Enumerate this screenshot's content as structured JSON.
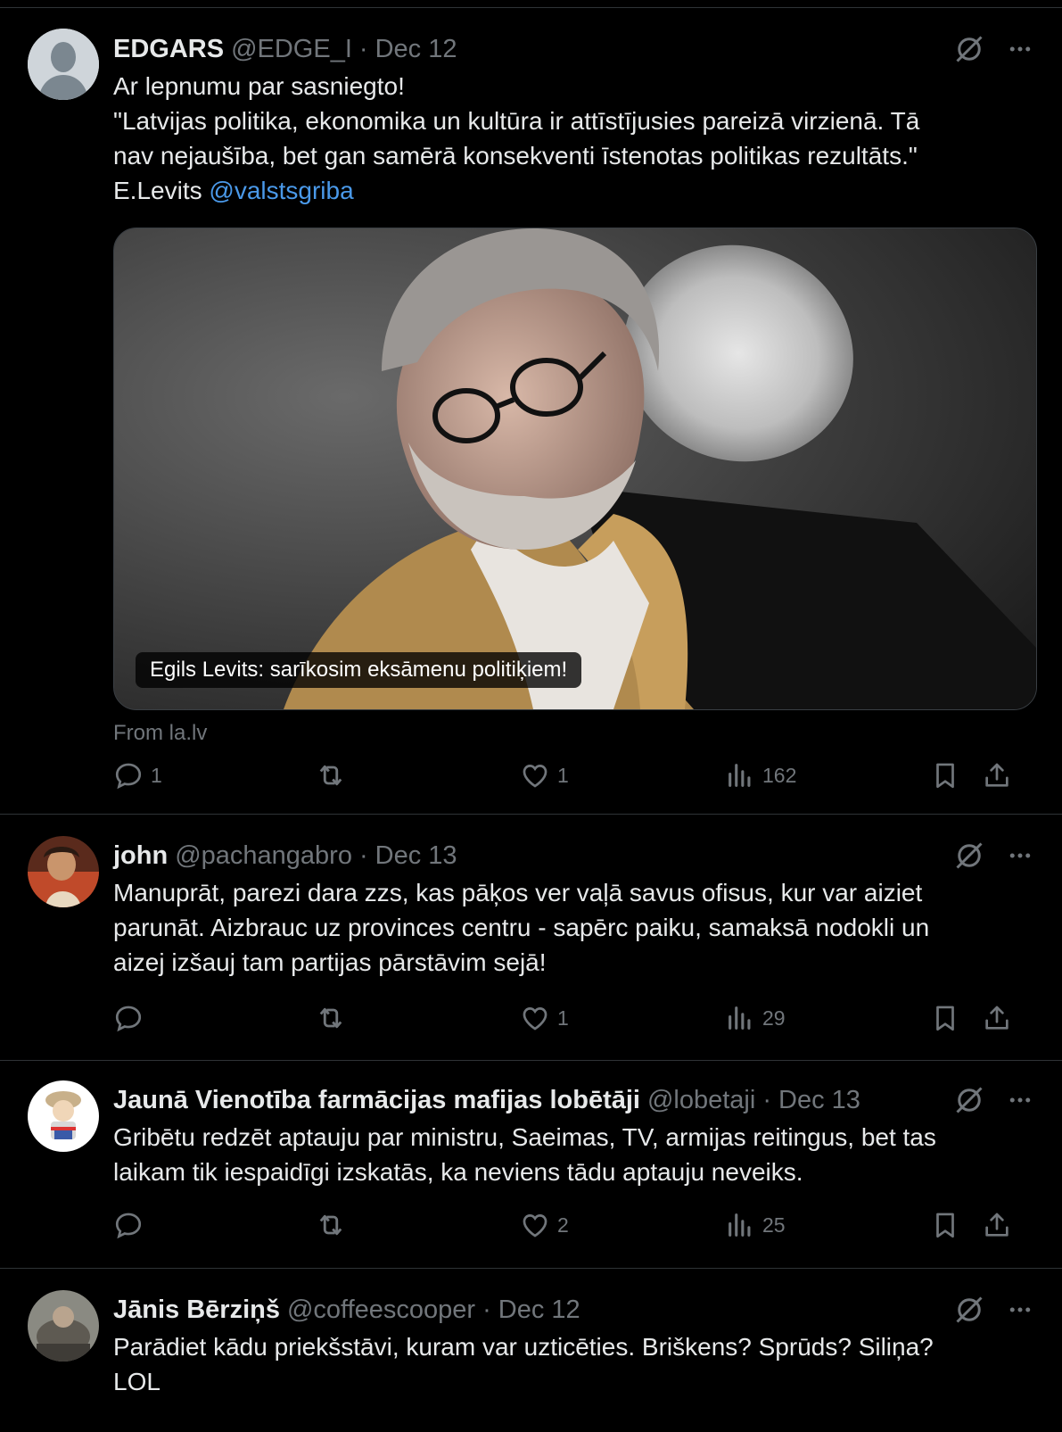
{
  "tweets": [
    {
      "name": "EDGARS",
      "handle": "@EDGE_I",
      "sep": "·",
      "date": "Dec 12",
      "lines": [
        "Ar lepnumu par sasniegto!",
        "\"Latvijas politika, ekonomika un kultūra ir attīstījusies pareizā virzienā. Tā",
        "nav nejaušība, bet gan samērā konsekventi īstenotas politikas rezultāts.\""
      ],
      "last_line_prefix": "E.Levits ",
      "mention": "@valstsgriba",
      "card_caption": "Egils Levits: sarīkosim eksāmenu politiķiem!",
      "card_source": "From la.lv",
      "replies": "1",
      "retweets": "",
      "likes": "1",
      "views": "162"
    },
    {
      "name": "john",
      "handle": "@pachangabro",
      "sep": "·",
      "date": "Dec 13",
      "lines": [
        "Manuprāt, parezi dara zzs, kas pāķos ver vaļā savus ofisus, kur var aiziet",
        "parunāt. Aizbrauc uz provinces centru - sapērc paiku, samaksā nodokli un",
        "aizej izšauj tam partijas pārstāvim sejā!"
      ],
      "replies": "",
      "retweets": "",
      "likes": "1",
      "views": "29"
    },
    {
      "name": "Jaunā Vienotība farmācijas mafijas lobētāji",
      "handle": "@lobetaji",
      "sep": "·",
      "date": "Dec 13",
      "lines": [
        "Gribētu redzēt aptauju par ministru, Saeimas, TV, armijas reitingus, bet tas",
        "laikam tik iespaidīgi izskatās, ka neviens tādu aptauju neveiks."
      ],
      "replies": "",
      "retweets": "",
      "likes": "2",
      "views": "25"
    },
    {
      "name": "Jānis Bērziņš",
      "handle": "@coffeescooper",
      "sep": "·",
      "date": "Dec 12",
      "lines": [
        "Parādiet kādu priekšstāvi, kuram var uzticēties. Briškens? Sprūds? Siliņa?",
        "LOL"
      ]
    }
  ],
  "colors": {
    "background": "#000000",
    "text": "#e7e9ea",
    "muted": "#71767b",
    "link": "#4a99e9",
    "divider": "#2f3336"
  },
  "icons": [
    "grok-icon",
    "more-icon",
    "reply-icon",
    "retweet-icon",
    "like-icon",
    "views-icon",
    "bookmark-icon",
    "share-icon"
  ]
}
